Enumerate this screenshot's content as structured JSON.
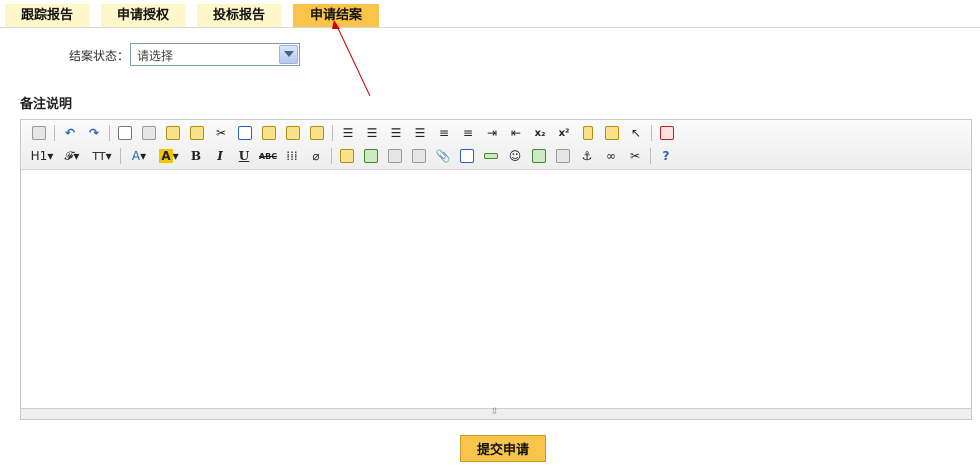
{
  "tabs": [
    {
      "label": "跟踪报告",
      "active": false
    },
    {
      "label": "申请授权",
      "active": false
    },
    {
      "label": "投标报告",
      "active": false
    },
    {
      "label": "申请结案",
      "active": true
    }
  ],
  "status": {
    "label": "结案状态：",
    "selected": "请选择"
  },
  "remarks": {
    "title": "备注说明"
  },
  "editor": {
    "row1_icons": [
      "source-icon",
      "undo-icon",
      "redo-icon",
      "preview-icon",
      "print-icon",
      "template-icon",
      "code-icon",
      "cut-icon",
      "copy-icon",
      "paste-icon",
      "paste-text-icon",
      "paste-word-icon",
      "align-left-icon",
      "align-center-icon",
      "align-right-icon",
      "justify-icon",
      "ordered-list-icon",
      "unordered-list-icon",
      "indent-icon",
      "outdent-icon",
      "subscript-icon",
      "superscript-icon",
      "clear-format-icon",
      "select-all-icon",
      "cursor-icon",
      "fullscreen-icon"
    ],
    "row2": {
      "heading": "H1",
      "font": "𝓕",
      "font_size": "TT",
      "font_color": "A",
      "highlight": "A",
      "bold": "B",
      "italic": "I",
      "underline": "U",
      "strike": "ABC"
    },
    "row2_icons": [
      "image-icon",
      "multi-image-icon",
      "flash-icon",
      "media-icon",
      "attachment-icon",
      "table-icon",
      "horizontal-rule-icon",
      "emoticon-icon",
      "map-icon",
      "page-break-icon",
      "anchor-icon",
      "link-icon",
      "unlink-icon",
      "help-icon"
    ],
    "content": ""
  },
  "submit": {
    "label": "提交申请"
  },
  "colors": {
    "tab_bg": "#fdf7c9",
    "tab_active_bg": "#f8c54a",
    "button_bg": "#f8c54a"
  }
}
